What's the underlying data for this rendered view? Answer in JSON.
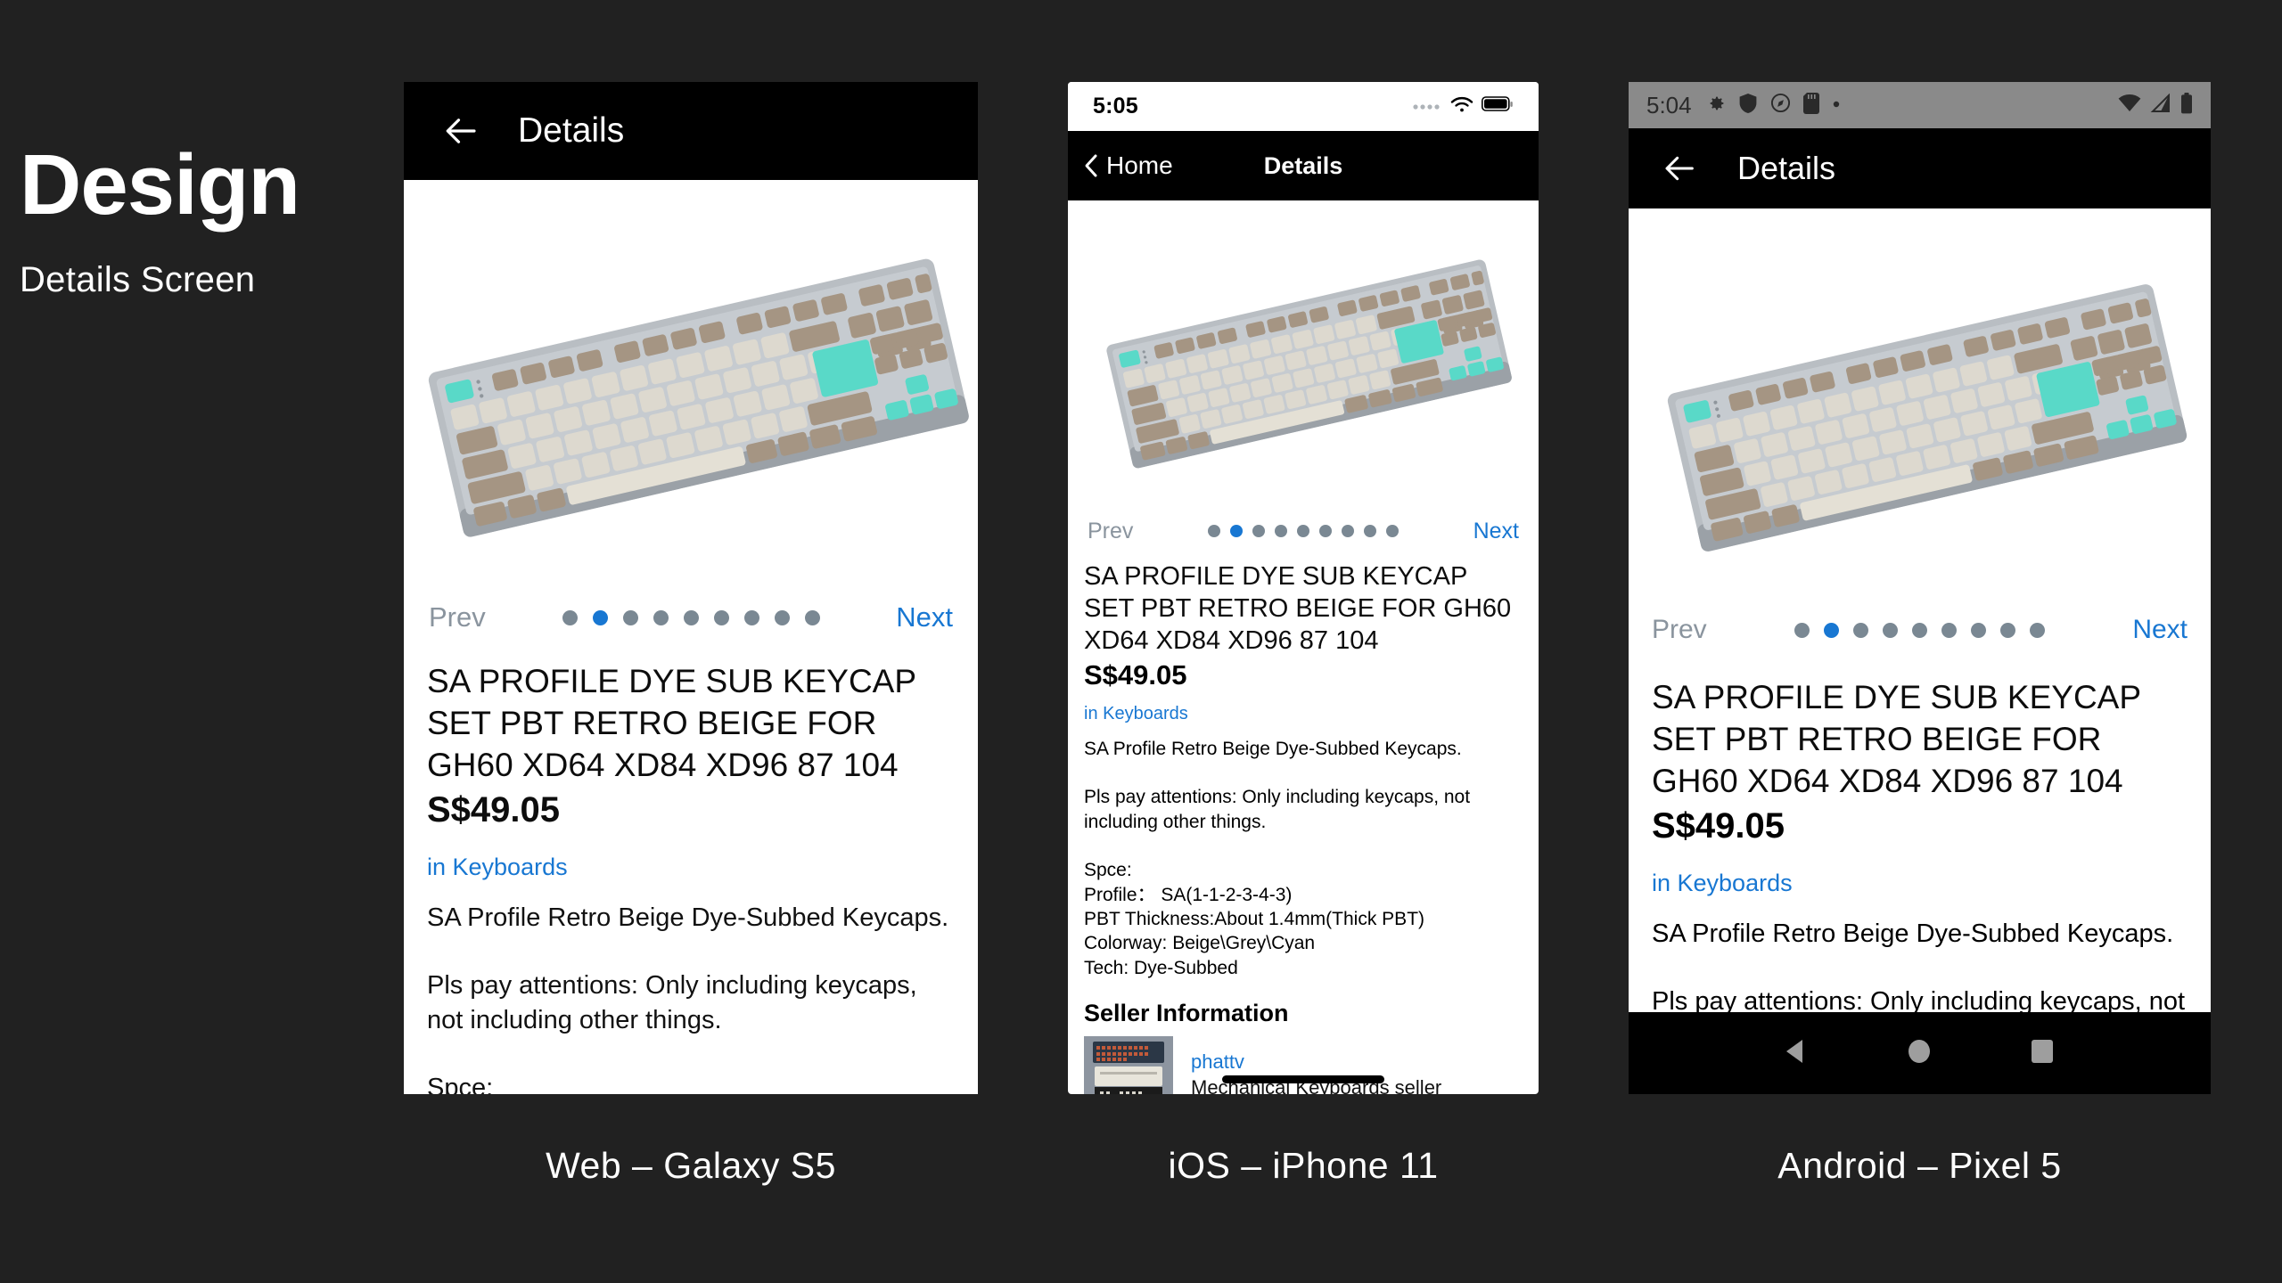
{
  "page": {
    "background_color": "#212121",
    "title": "Design",
    "subtitle": "Details Screen"
  },
  "colors": {
    "accent_blue": "#1877d2",
    "dot_inactive": "#7a8893",
    "prev_gray": "#8a949e",
    "topbar_black": "#000000",
    "android_statusbar_gray": "#8a8a8a"
  },
  "product": {
    "title": "SA PROFILE DYE SUB KEYCAP SET PBT RETRO BEIGE FOR GH60 XD64 XD84 XD96 87 104",
    "price": "S$49.05",
    "category": "in Keyboards",
    "description_line1": "SA Profile Retro Beige Dye-Subbed Keycaps.",
    "description_line2": "Pls pay attentions: Only including keycaps, not including other things.",
    "spec_header": "Spce:",
    "spec_profile": "Profile： SA(1-1-2-3-4-3)",
    "spec_thickness": "PBT Thickness:About 1.4mm(Thick PBT)",
    "spec_colorway": "Colorway: Beige\\Grey\\Cyan",
    "spec_tech": "Tech: Dye-Subbed",
    "web_description_block": "SA Profile Retro Beige Dye-Subbed Keycaps.\n\nPls pay attentions: Only including keycaps, not including other things.\n\nSpce:\nProfile： SA(1-1-2-3-4-3)\nPBT Thickness:About 1.4mm(Thick PBT)",
    "ios_description_block": "SA Profile Retro Beige Dye-Subbed Keycaps.\n\nPls pay attentions: Only including keycaps, not including other things.\n\nSpce:\nProfile： SA(1-1-2-3-4-3)\nPBT Thickness:About 1.4mm(Thick PBT)\nColorway: Beige\\Grey\\Cyan\nTech: Dye-Subbed",
    "android_description_block": "SA Profile Retro Beige Dye-Subbed Keycaps.\n\nPls pay attentions: Only including keycaps, not including other things."
  },
  "carousel": {
    "prev_label": "Prev",
    "next_label": "Next",
    "total_dots": 9,
    "active_index": 1
  },
  "seller": {
    "section_title": "Seller Information",
    "name": "phattv",
    "role": "Mechanical Keyboards seller"
  },
  "web": {
    "caption": "Web – Galaxy S5",
    "topbar_title": "Details",
    "back_icon": "arrow-left-icon"
  },
  "ios": {
    "caption": "iOS – iPhone 11",
    "status_time": "5:05",
    "status_icons": [
      "signal-dots-icon",
      "wifi-icon",
      "battery-icon"
    ],
    "nav_back_label": "Home",
    "nav_title": "Details"
  },
  "android": {
    "caption": "Android – Pixel 5",
    "status_time": "5:04",
    "status_icons_left": [
      "gear-icon",
      "shield-icon",
      "compass-icon",
      "sdcard-icon",
      "dot-icon"
    ],
    "status_icons_right": [
      "wifi-icon",
      "cell-signal-icon",
      "battery-icon"
    ],
    "topbar_title": "Details",
    "back_icon": "arrow-left-icon",
    "sysnav": [
      "back-triangle-icon",
      "home-circle-icon",
      "recents-square-icon"
    ]
  }
}
